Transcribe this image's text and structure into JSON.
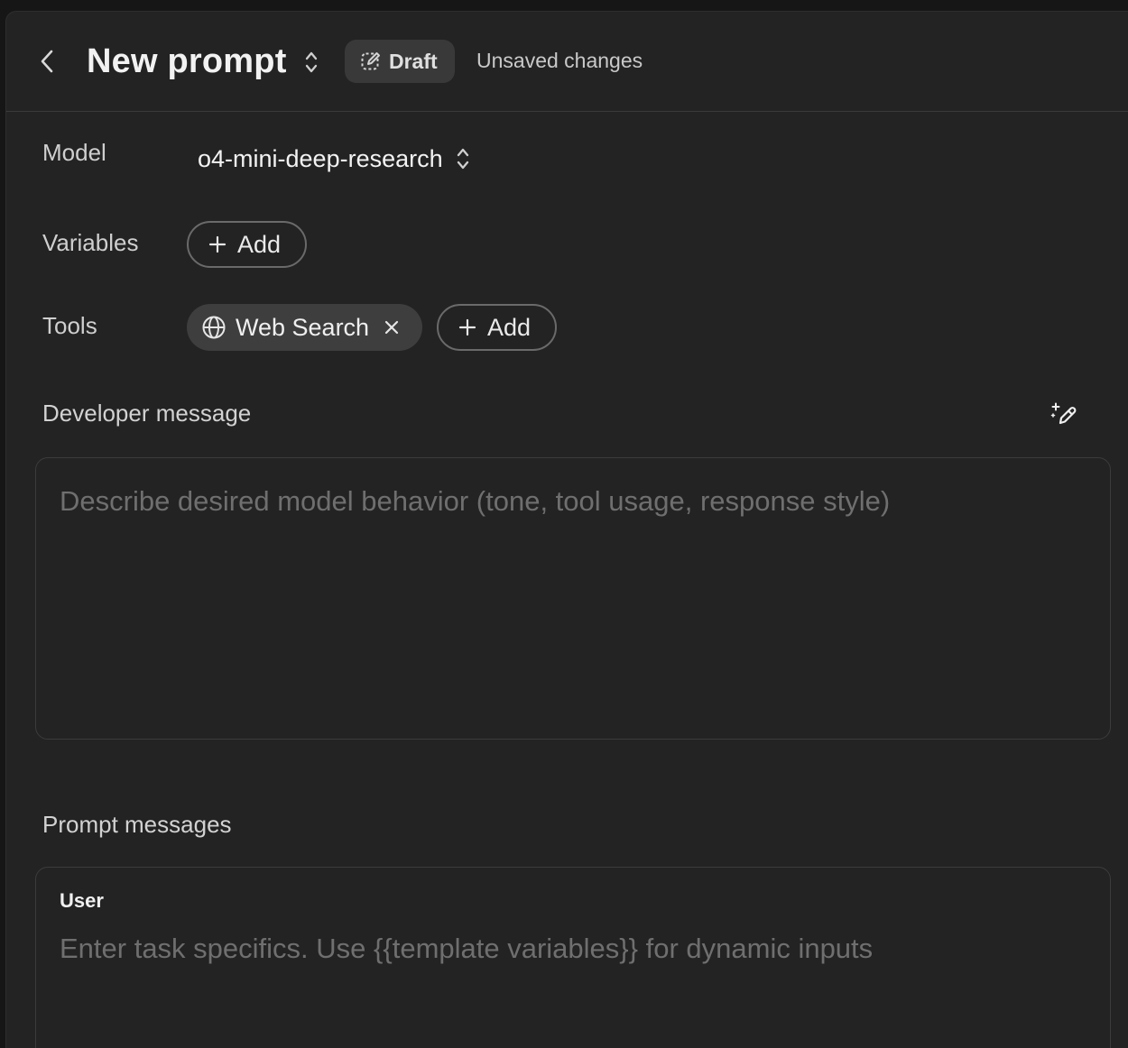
{
  "header": {
    "title": "New prompt",
    "status_badge": "Draft",
    "unsaved_text": "Unsaved changes"
  },
  "model": {
    "label": "Model",
    "value": "o4-mini-deep-research"
  },
  "variables": {
    "label": "Variables",
    "add_label": "Add"
  },
  "tools": {
    "label": "Tools",
    "items": [
      {
        "label": "Web Search",
        "icon": "globe-icon"
      }
    ],
    "add_label": "Add"
  },
  "developer_message": {
    "title": "Developer message",
    "placeholder": "Describe desired model behavior (tone, tool usage, response style)",
    "value": ""
  },
  "prompt_messages": {
    "title": "Prompt messages",
    "messages": [
      {
        "role": "User",
        "placeholder": "Enter task specifics. Use {{template variables}} for dynamic inputs",
        "value": ""
      }
    ]
  },
  "colors": {
    "background": "#161616",
    "panel": "#232323",
    "badge": "#393939",
    "pill_filled": "#3e3e3e",
    "placeholder": "#6f6f6f"
  }
}
